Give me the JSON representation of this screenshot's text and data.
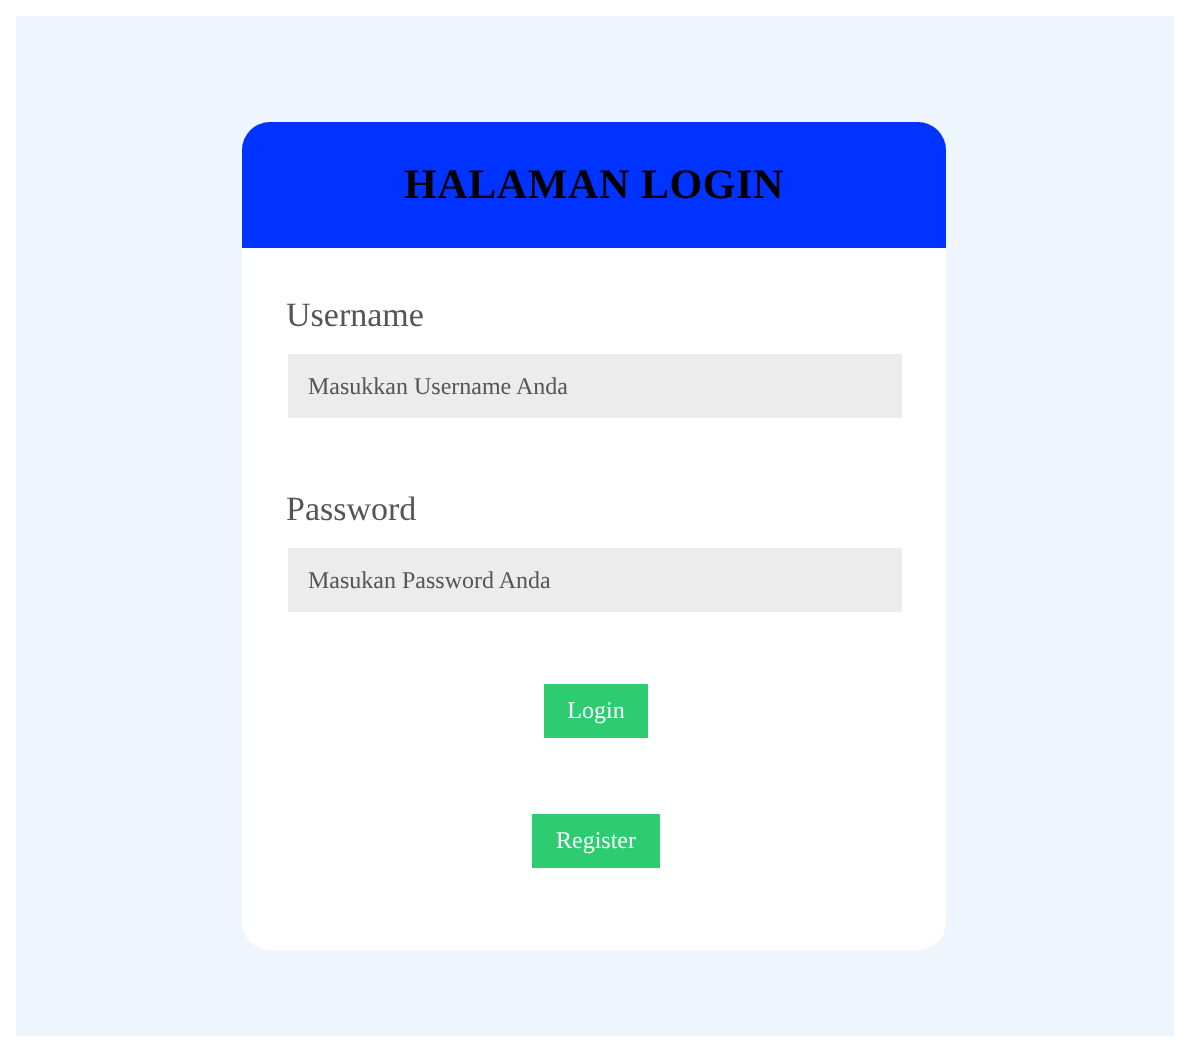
{
  "title": "HALAMAN LOGIN",
  "fields": [
    {
      "label": "Username",
      "placeholder": "Masukkan Username Anda"
    },
    {
      "label": "Password",
      "placeholder": "Masukan Password Anda"
    }
  ],
  "buttons": [
    "Login",
    "Register"
  ]
}
